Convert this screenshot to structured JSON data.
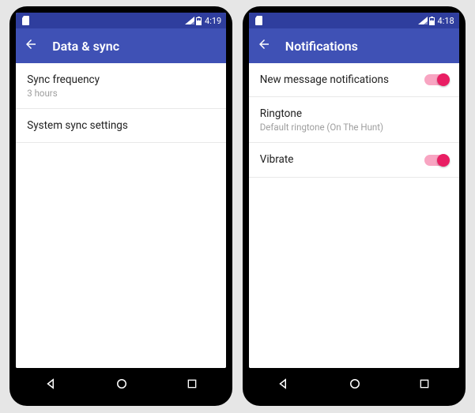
{
  "left": {
    "status_time": "4:19",
    "appbar_title": "Data & sync",
    "rows": [
      {
        "title": "Sync frequency",
        "subtitle": "3 hours"
      },
      {
        "title": "System sync settings",
        "subtitle": ""
      }
    ]
  },
  "right": {
    "status_time": "4:18",
    "appbar_title": "Notifications",
    "rows": [
      {
        "title": "New message notifications",
        "subtitle": "",
        "toggle": true
      },
      {
        "title": "Ringtone",
        "subtitle": "Default ringtone (On The Hunt)",
        "toggle": false
      },
      {
        "title": "Vibrate",
        "subtitle": "",
        "toggle": true
      }
    ]
  },
  "colors": {
    "primary": "#3f51b5",
    "primaryDark": "#2f3e9e",
    "accent": "#e91e63"
  }
}
